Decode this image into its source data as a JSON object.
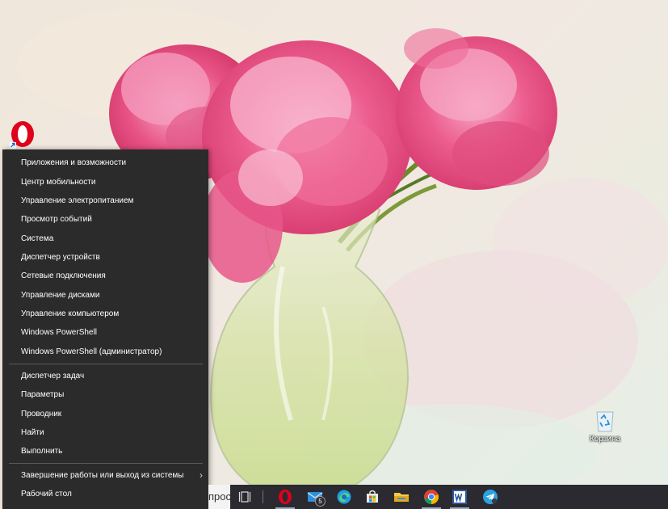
{
  "desktop": {
    "recycle_bin_label": "Корзина"
  },
  "menu": {
    "items_group1": [
      "Приложения и возможности",
      "Центр мобильности",
      "Управление электропитанием",
      "Просмотр событий",
      "Система",
      "Диспетчер устройств",
      "Сетевые подключения",
      "Управление дисками",
      "Управление компьютером",
      "Windows PowerShell",
      "Windows PowerShell (администратор)"
    ],
    "items_group2": [
      "Диспетчер задач",
      "Параметры",
      "Проводник",
      "Найти",
      "Выполнить"
    ],
    "shutdown_label": "Завершение работы или выход из системы",
    "desktop_label": "Рабочий стол"
  },
  "taskbar": {
    "search_stub_text": "прос",
    "mail_badge": "5",
    "icons": [
      "task-view-icon",
      "opera-icon",
      "mail-icon",
      "edge-icon",
      "store-icon",
      "file-explorer-icon",
      "chrome-icon",
      "word-icon",
      "telegram-icon"
    ],
    "colors": {
      "opera": "#e0001b",
      "chrome_red": "#db4437",
      "word": "#2b579a",
      "telegram": "#2aa3e0",
      "edge": "#1aa0e3"
    }
  }
}
